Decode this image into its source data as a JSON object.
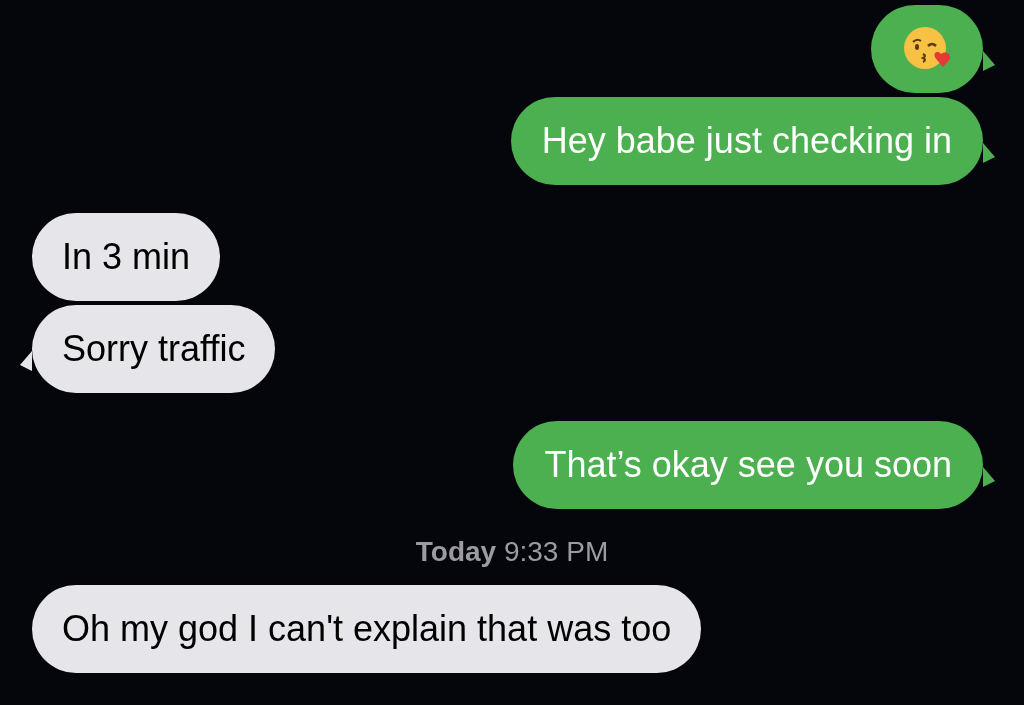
{
  "messages": [
    {
      "kind": "sent_emoji",
      "tail": true
    },
    {
      "kind": "sent",
      "text": "Hey babe just checking in",
      "tail": true
    },
    {
      "kind": "received",
      "text": "In 3 min",
      "tail": false
    },
    {
      "kind": "received",
      "text": "Sorry traffic",
      "tail": true
    },
    {
      "kind": "sent",
      "text": "That’s okay see you soon",
      "tail": true
    },
    {
      "kind": "timestamp",
      "text": "**Today** 9:33 PM"
    },
    {
      "kind": "received",
      "text": "Oh my god I can't explain that was too",
      "tail": false
    }
  ]
}
